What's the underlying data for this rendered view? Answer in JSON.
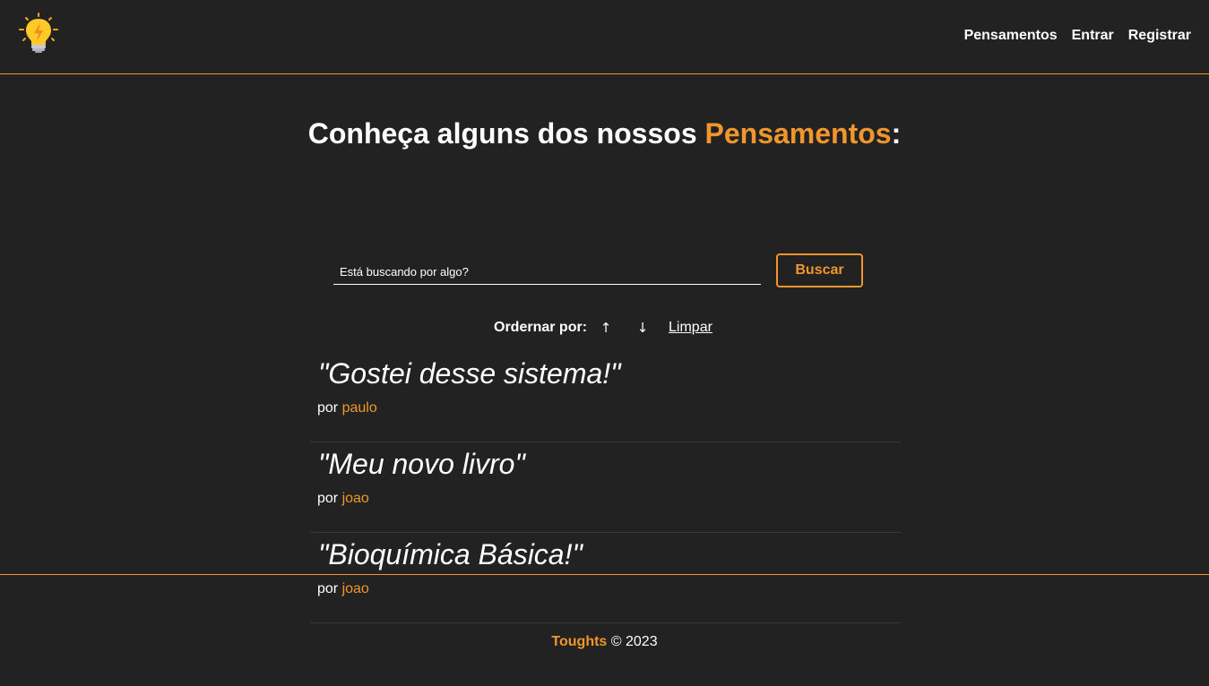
{
  "navbar": {
    "logo_icon": "lightbulb-icon",
    "links": [
      "Pensamentos",
      "Entrar",
      "Registrar"
    ]
  },
  "header": {
    "title_prefix": "Conheça alguns dos nossos ",
    "title_highlight": "Pensamentos",
    "title_suffix": ":"
  },
  "search": {
    "placeholder": "Está buscando por algo?",
    "value": "",
    "button_label": "Buscar"
  },
  "order": {
    "label": "Ordernar por:",
    "asc_symbol": "↑",
    "desc_symbol": "↓",
    "clear_label": "Limpar"
  },
  "thoughts": [
    {
      "title": "\"Gostei desse sistema!\"",
      "by": "por ",
      "author": "paulo"
    },
    {
      "title": "\"Meu novo livro\"",
      "by": "por ",
      "author": "joao"
    },
    {
      "title": "\"Bioquímica Básica!\"",
      "by": "por ",
      "author": "joao"
    }
  ],
  "footer": {
    "brand": "Toughts",
    "copyright": " © 2023"
  },
  "colors": {
    "background": "#222222",
    "accent": "#f0962d",
    "text": "#ffffff"
  }
}
